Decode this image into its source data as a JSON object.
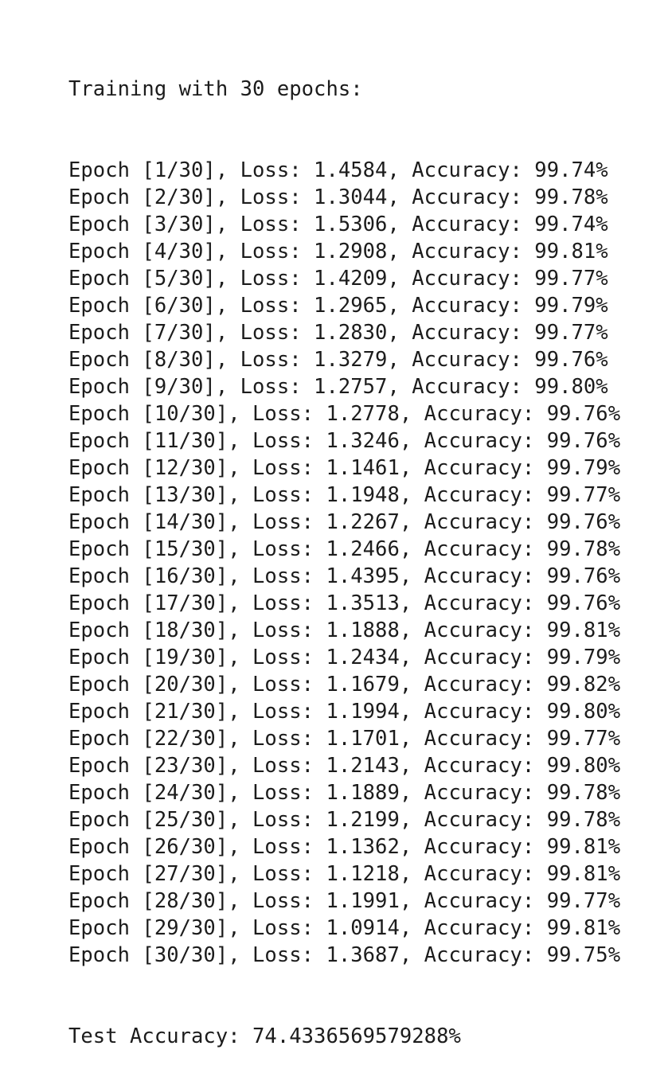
{
  "output": {
    "header": "Training with 30 epochs:",
    "epochs": [
      "Epoch [1/30], Loss: 1.4584, Accuracy: 99.74%",
      "Epoch [2/30], Loss: 1.3044, Accuracy: 99.78%",
      "Epoch [3/30], Loss: 1.5306, Accuracy: 99.74%",
      "Epoch [4/30], Loss: 1.2908, Accuracy: 99.81%",
      "Epoch [5/30], Loss: 1.4209, Accuracy: 99.77%",
      "Epoch [6/30], Loss: 1.2965, Accuracy: 99.79%",
      "Epoch [7/30], Loss: 1.2830, Accuracy: 99.77%",
      "Epoch [8/30], Loss: 1.3279, Accuracy: 99.76%",
      "Epoch [9/30], Loss: 1.2757, Accuracy: 99.80%",
      "Epoch [10/30], Loss: 1.2778, Accuracy: 99.76%",
      "Epoch [11/30], Loss: 1.3246, Accuracy: 99.76%",
      "Epoch [12/30], Loss: 1.1461, Accuracy: 99.79%",
      "Epoch [13/30], Loss: 1.1948, Accuracy: 99.77%",
      "Epoch [14/30], Loss: 1.2267, Accuracy: 99.76%",
      "Epoch [15/30], Loss: 1.2466, Accuracy: 99.78%",
      "Epoch [16/30], Loss: 1.4395, Accuracy: 99.76%",
      "Epoch [17/30], Loss: 1.3513, Accuracy: 99.76%",
      "Epoch [18/30], Loss: 1.1888, Accuracy: 99.81%",
      "Epoch [19/30], Loss: 1.2434, Accuracy: 99.79%",
      "Epoch [20/30], Loss: 1.1679, Accuracy: 99.82%",
      "Epoch [21/30], Loss: 1.1994, Accuracy: 99.80%",
      "Epoch [22/30], Loss: 1.1701, Accuracy: 99.77%",
      "Epoch [23/30], Loss: 1.2143, Accuracy: 99.80%",
      "Epoch [24/30], Loss: 1.1889, Accuracy: 99.78%",
      "Epoch [25/30], Loss: 1.2199, Accuracy: 99.78%",
      "Epoch [26/30], Loss: 1.1362, Accuracy: 99.81%",
      "Epoch [27/30], Loss: 1.1218, Accuracy: 99.81%",
      "Epoch [28/30], Loss: 1.1991, Accuracy: 99.77%",
      "Epoch [29/30], Loss: 1.0914, Accuracy: 99.81%",
      "Epoch [30/30], Loss: 1.3687, Accuracy: 99.75%"
    ],
    "footer": "Test Accuracy: 74.4336569579288%"
  }
}
